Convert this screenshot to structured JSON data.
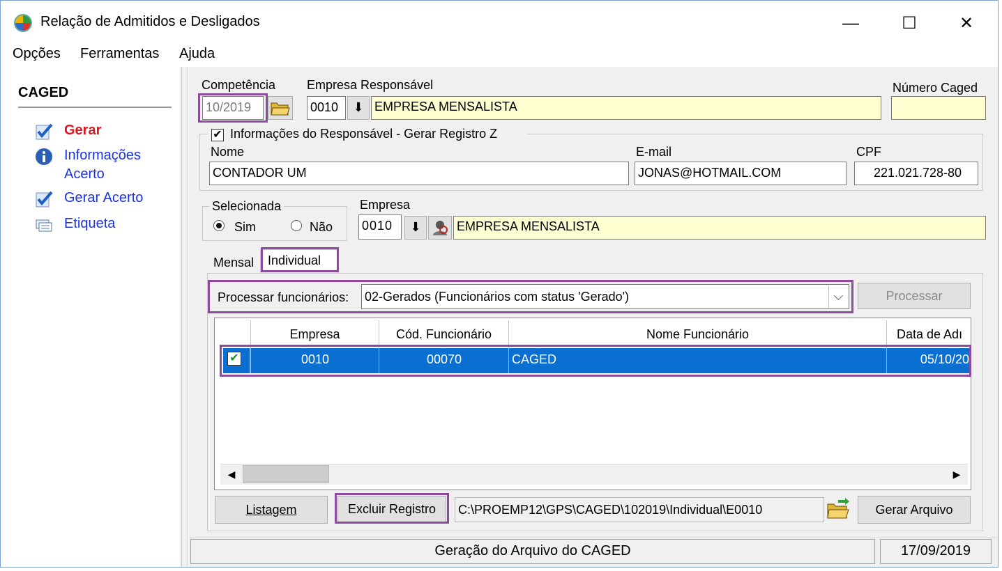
{
  "window": {
    "title": "Relação de Admitidos e Desligados",
    "minimize": "—",
    "maximize": "☐",
    "close": "✕"
  },
  "menu": [
    "Opções",
    "Ferramentas",
    "Ajuda"
  ],
  "sidebar": {
    "title": "CAGED",
    "items": [
      {
        "label": "Gerar",
        "icon": "checklist-icon",
        "color": "#e0141e"
      },
      {
        "label": "Informações",
        "label2": "Acerto",
        "icon": "info-icon",
        "color": "#1a32e6"
      },
      {
        "label": "Gerar Acerto",
        "icon": "checklist-icon",
        "color": "#1a32e6"
      },
      {
        "label": "Etiqueta",
        "icon": "label-icon",
        "color": "#1a32e6"
      }
    ]
  },
  "form": {
    "competencia_label": "Competência",
    "competencia_value": "10/2019",
    "empresa_resp_label": "Empresa Responsável",
    "empresa_resp_code": "0010",
    "empresa_resp_name": "EMPRESA MENSALISTA",
    "numero_caged_label": "Número Caged",
    "numero_caged_value": "",
    "responsavel_group_label": "Informações do Responsável - Gerar Registro Z",
    "responsavel_checked": true,
    "nome_label": "Nome",
    "nome_value": "CONTADOR UM",
    "email_label": "E-mail",
    "email_value": "JONAS@HOTMAIL.COM",
    "cpf_label": "CPF",
    "cpf_value": "221.021.728-80",
    "selecionada_label": "Selecionada",
    "sim_label": "Sim",
    "nao_label": "Não",
    "selecionada_value": "Sim",
    "empresa_label": "Empresa",
    "empresa_code": "0010",
    "empresa_name": "EMPRESA MENSALISTA"
  },
  "tabs": [
    {
      "label": "Mensal",
      "active": false
    },
    {
      "label": "Individual",
      "active": true
    }
  ],
  "processar": {
    "label": "Processar funcionários:",
    "selected": "02-Gerados (Funcionários com status 'Gerado')",
    "button": "Processar"
  },
  "table": {
    "columns": [
      "Empresa",
      "Cód. Funcionário",
      "Nome Funcionário",
      "Data de Adı"
    ],
    "rows": [
      {
        "checked": true,
        "empresa": "0010",
        "codigo": "00070",
        "nome": "CAGED",
        "data": "05/10/20"
      }
    ]
  },
  "actions": {
    "listagem": "Listagem",
    "excluir": "Excluir Registro",
    "path": "C:\\PROEMP12\\GPS\\CAGED\\102019\\Individual\\E0010",
    "gerar_arquivo": "Gerar Arquivo"
  },
  "status": {
    "message": "Geração do Arquivo do CAGED",
    "date": "17/09/2019"
  },
  "colors": {
    "highlight": "#8e4a9e",
    "selected_row": "#0b6fd1",
    "yellow_field": "#ffffd2"
  }
}
